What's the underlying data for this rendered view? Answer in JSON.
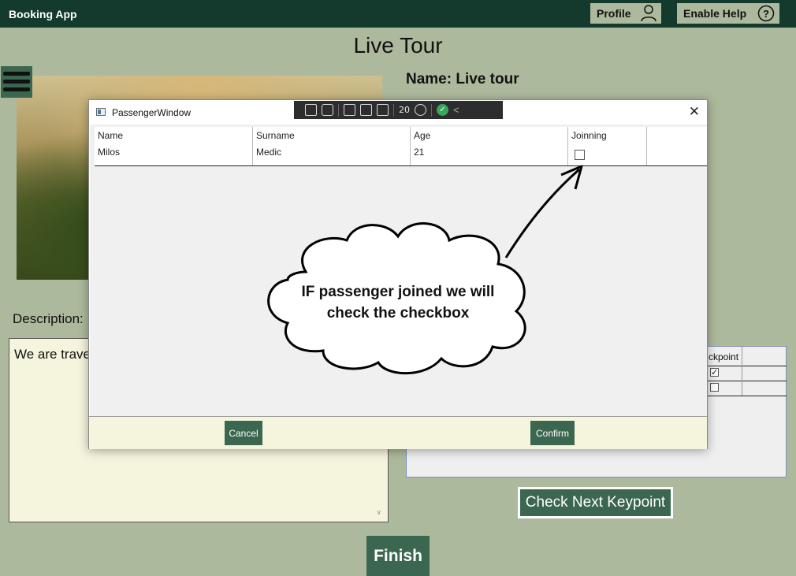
{
  "app": {
    "title": "Booking App"
  },
  "header": {
    "profile_label": "Profile",
    "help_label": "Enable Help"
  },
  "page": {
    "title": "Live Tour",
    "name_label": "Name: Live tour",
    "description_label": "Description:",
    "description_text": "We are trave",
    "keypoints_header": "ckpoint",
    "keypoints_checked": [
      true,
      false
    ],
    "next_button": "Check Next Keypoint",
    "finish_button": "Finish"
  },
  "dialog": {
    "title": "PassengerWindow",
    "columns": [
      "Name",
      "Surname",
      "Age",
      "Joinning"
    ],
    "rows": [
      {
        "name": "Milos",
        "surname": "Medic",
        "age": "21",
        "joining": false
      }
    ],
    "cancel_label": "Cancel",
    "confirm_label": "Confirm",
    "debug_counter": "20"
  },
  "annotation": {
    "line1": "IF passenger joined  we will",
    "line2": "check the checkbox"
  },
  "colors": {
    "background": "#adb99c",
    "topbar": "#133a2c",
    "accent_button": "#3b6650",
    "textbox": "#f5f4dc"
  }
}
